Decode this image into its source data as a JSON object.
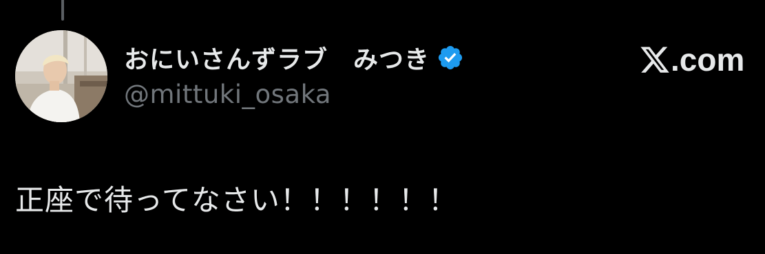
{
  "post": {
    "author": {
      "display_name": "おにいさんずラブ　みつき",
      "handle": "@mittuki_osaka",
      "verified": true,
      "verified_badge_color": "#1d9bf0"
    },
    "text": "正座で待ってなさい！！！！！！",
    "brand": {
      "icon": "x-logo-icon",
      "label": ".com"
    }
  },
  "theme": {
    "background": "#000000",
    "primary_text": "#e7e9ea",
    "secondary_text": "#71767b",
    "thread_line": "#5b5f63"
  }
}
